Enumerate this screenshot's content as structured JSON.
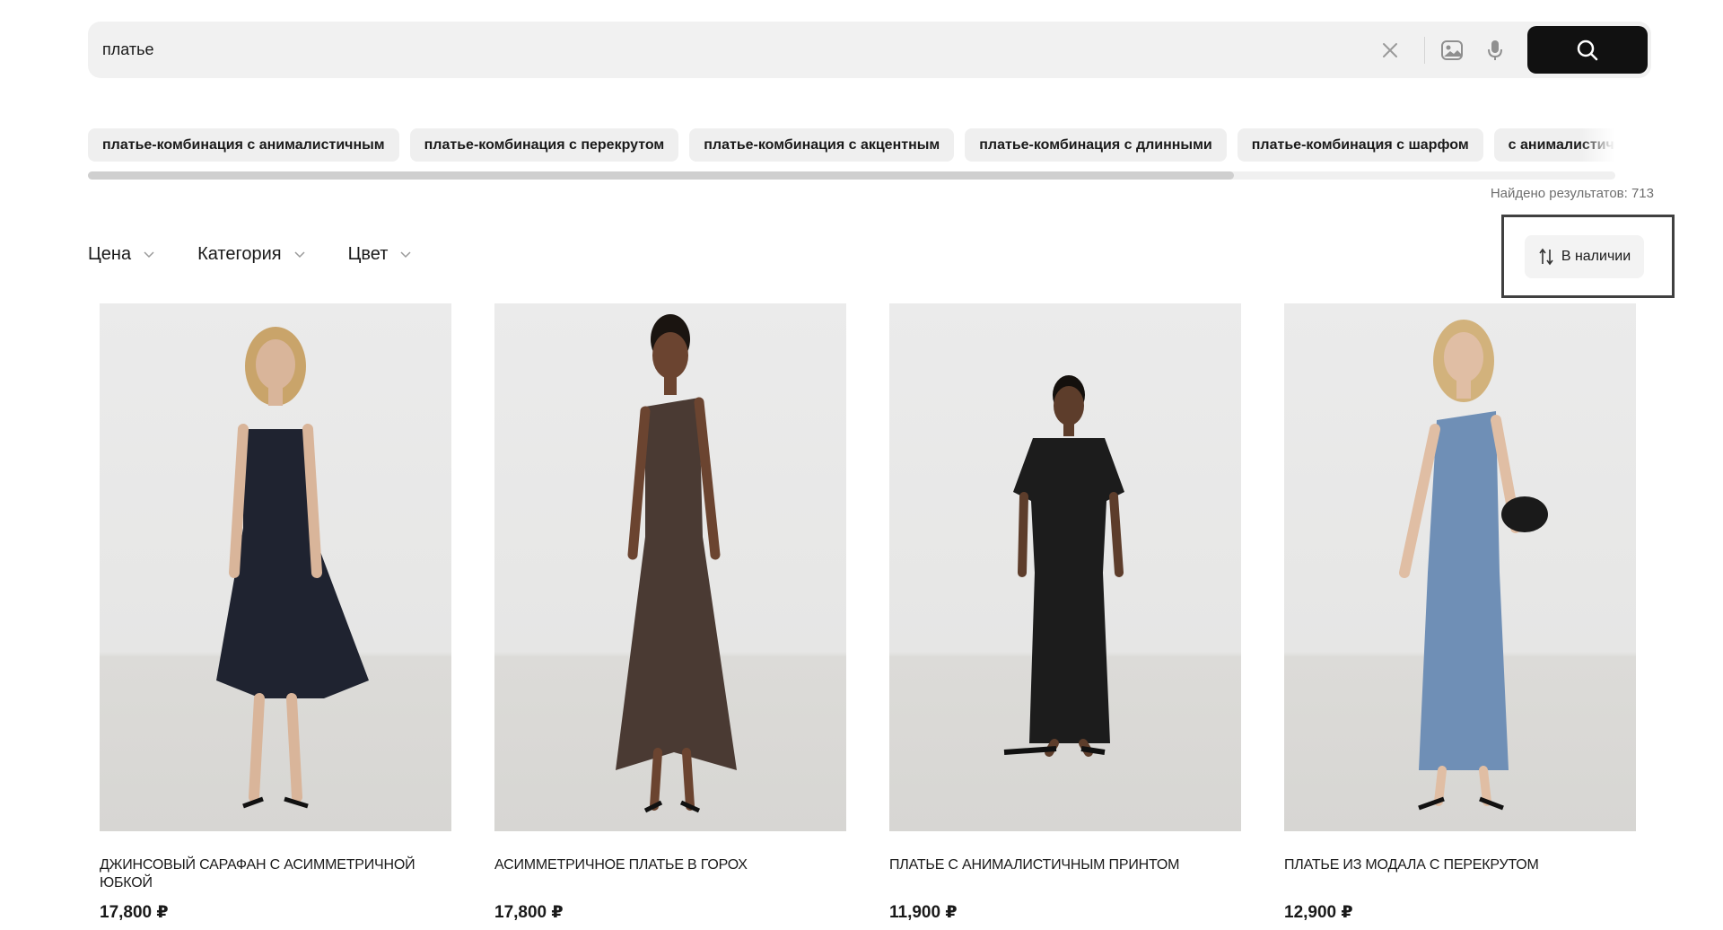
{
  "search": {
    "value": "платье",
    "icons": {
      "clear": "close-icon",
      "image_search": "image-search-icon",
      "voice": "microphone-icon",
      "submit": "search-icon"
    }
  },
  "suggestions": [
    "платье-комбинация с анималистичным",
    "платье-комбинация с перекрутом",
    "платье-комбинация с акцентным",
    "платье-комбинация с длинными",
    "платье-комбинация с шарфом",
    "с анималистичным"
  ],
  "chips_scroll": {
    "visible_fraction": 0.75
  },
  "results": {
    "label": "Найдено результатов: 713"
  },
  "filters": [
    {
      "label": "Цена",
      "icon": "chevron-down-icon"
    },
    {
      "label": "Категория",
      "icon": "chevron-down-icon"
    },
    {
      "label": "Цвет",
      "icon": "chevron-down-icon"
    }
  ],
  "sort": {
    "label": "В наличии",
    "icon": "sort-arrows-icon"
  },
  "products": [
    {
      "title": "ДЖИНСОВЫЙ САРАФАН С АСИММЕТРИЧНОЙ ЮБКОЙ",
      "price": "17,800 ₽",
      "dress_color": "#1f2330",
      "skin": "#d9b59a",
      "hair": "#c9a46a"
    },
    {
      "title": "АСИММЕТРИЧНОЕ ПЛАТЬЕ В ГОРОХ",
      "price": "17,800 ₽",
      "dress_color": "#4a3a33",
      "skin": "#6b4430",
      "hair": "#1a1410"
    },
    {
      "title": "ПЛАТЬЕ С АНИМАЛИСТИЧНЫМ ПРИНТОМ",
      "price": "11,900 ₽",
      "dress_color": "#1c1c1c",
      "skin": "#5d3d2b",
      "hair": "#14100d"
    },
    {
      "title": "ПЛАТЬЕ ИЗ МОДАЛА С ПЕРЕКРУТОМ",
      "price": "12,900 ₽",
      "dress_color": "#6f8fb6",
      "skin": "#e0bea4",
      "hair": "#d2b27c"
    }
  ],
  "colors": {
    "accent": "#111111",
    "chip_bg": "#efefef",
    "search_bg": "#f1f1f1"
  }
}
